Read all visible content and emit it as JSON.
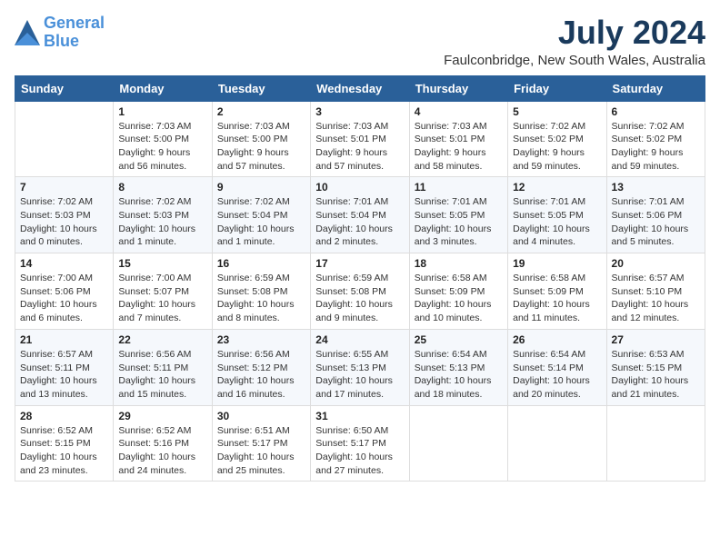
{
  "header": {
    "logo_line1": "General",
    "logo_line2": "Blue",
    "month_title": "July 2024",
    "location": "Faulconbridge, New South Wales, Australia"
  },
  "days_of_week": [
    "Sunday",
    "Monday",
    "Tuesday",
    "Wednesday",
    "Thursday",
    "Friday",
    "Saturday"
  ],
  "weeks": [
    [
      {
        "num": "",
        "sunrise": "",
        "sunset": "",
        "daylight": ""
      },
      {
        "num": "1",
        "sunrise": "Sunrise: 7:03 AM",
        "sunset": "Sunset: 5:00 PM",
        "daylight": "Daylight: 9 hours and 56 minutes."
      },
      {
        "num": "2",
        "sunrise": "Sunrise: 7:03 AM",
        "sunset": "Sunset: 5:00 PM",
        "daylight": "Daylight: 9 hours and 57 minutes."
      },
      {
        "num": "3",
        "sunrise": "Sunrise: 7:03 AM",
        "sunset": "Sunset: 5:01 PM",
        "daylight": "Daylight: 9 hours and 57 minutes."
      },
      {
        "num": "4",
        "sunrise": "Sunrise: 7:03 AM",
        "sunset": "Sunset: 5:01 PM",
        "daylight": "Daylight: 9 hours and 58 minutes."
      },
      {
        "num": "5",
        "sunrise": "Sunrise: 7:02 AM",
        "sunset": "Sunset: 5:02 PM",
        "daylight": "Daylight: 9 hours and 59 minutes."
      },
      {
        "num": "6",
        "sunrise": "Sunrise: 7:02 AM",
        "sunset": "Sunset: 5:02 PM",
        "daylight": "Daylight: 9 hours and 59 minutes."
      }
    ],
    [
      {
        "num": "7",
        "sunrise": "Sunrise: 7:02 AM",
        "sunset": "Sunset: 5:03 PM",
        "daylight": "Daylight: 10 hours and 0 minutes."
      },
      {
        "num": "8",
        "sunrise": "Sunrise: 7:02 AM",
        "sunset": "Sunset: 5:03 PM",
        "daylight": "Daylight: 10 hours and 1 minute."
      },
      {
        "num": "9",
        "sunrise": "Sunrise: 7:02 AM",
        "sunset": "Sunset: 5:04 PM",
        "daylight": "Daylight: 10 hours and 1 minute."
      },
      {
        "num": "10",
        "sunrise": "Sunrise: 7:01 AM",
        "sunset": "Sunset: 5:04 PM",
        "daylight": "Daylight: 10 hours and 2 minutes."
      },
      {
        "num": "11",
        "sunrise": "Sunrise: 7:01 AM",
        "sunset": "Sunset: 5:05 PM",
        "daylight": "Daylight: 10 hours and 3 minutes."
      },
      {
        "num": "12",
        "sunrise": "Sunrise: 7:01 AM",
        "sunset": "Sunset: 5:05 PM",
        "daylight": "Daylight: 10 hours and 4 minutes."
      },
      {
        "num": "13",
        "sunrise": "Sunrise: 7:01 AM",
        "sunset": "Sunset: 5:06 PM",
        "daylight": "Daylight: 10 hours and 5 minutes."
      }
    ],
    [
      {
        "num": "14",
        "sunrise": "Sunrise: 7:00 AM",
        "sunset": "Sunset: 5:06 PM",
        "daylight": "Daylight: 10 hours and 6 minutes."
      },
      {
        "num": "15",
        "sunrise": "Sunrise: 7:00 AM",
        "sunset": "Sunset: 5:07 PM",
        "daylight": "Daylight: 10 hours and 7 minutes."
      },
      {
        "num": "16",
        "sunrise": "Sunrise: 6:59 AM",
        "sunset": "Sunset: 5:08 PM",
        "daylight": "Daylight: 10 hours and 8 minutes."
      },
      {
        "num": "17",
        "sunrise": "Sunrise: 6:59 AM",
        "sunset": "Sunset: 5:08 PM",
        "daylight": "Daylight: 10 hours and 9 minutes."
      },
      {
        "num": "18",
        "sunrise": "Sunrise: 6:58 AM",
        "sunset": "Sunset: 5:09 PM",
        "daylight": "Daylight: 10 hours and 10 minutes."
      },
      {
        "num": "19",
        "sunrise": "Sunrise: 6:58 AM",
        "sunset": "Sunset: 5:09 PM",
        "daylight": "Daylight: 10 hours and 11 minutes."
      },
      {
        "num": "20",
        "sunrise": "Sunrise: 6:57 AM",
        "sunset": "Sunset: 5:10 PM",
        "daylight": "Daylight: 10 hours and 12 minutes."
      }
    ],
    [
      {
        "num": "21",
        "sunrise": "Sunrise: 6:57 AM",
        "sunset": "Sunset: 5:11 PM",
        "daylight": "Daylight: 10 hours and 13 minutes."
      },
      {
        "num": "22",
        "sunrise": "Sunrise: 6:56 AM",
        "sunset": "Sunset: 5:11 PM",
        "daylight": "Daylight: 10 hours and 15 minutes."
      },
      {
        "num": "23",
        "sunrise": "Sunrise: 6:56 AM",
        "sunset": "Sunset: 5:12 PM",
        "daylight": "Daylight: 10 hours and 16 minutes."
      },
      {
        "num": "24",
        "sunrise": "Sunrise: 6:55 AM",
        "sunset": "Sunset: 5:13 PM",
        "daylight": "Daylight: 10 hours and 17 minutes."
      },
      {
        "num": "25",
        "sunrise": "Sunrise: 6:54 AM",
        "sunset": "Sunset: 5:13 PM",
        "daylight": "Daylight: 10 hours and 18 minutes."
      },
      {
        "num": "26",
        "sunrise": "Sunrise: 6:54 AM",
        "sunset": "Sunset: 5:14 PM",
        "daylight": "Daylight: 10 hours and 20 minutes."
      },
      {
        "num": "27",
        "sunrise": "Sunrise: 6:53 AM",
        "sunset": "Sunset: 5:15 PM",
        "daylight": "Daylight: 10 hours and 21 minutes."
      }
    ],
    [
      {
        "num": "28",
        "sunrise": "Sunrise: 6:52 AM",
        "sunset": "Sunset: 5:15 PM",
        "daylight": "Daylight: 10 hours and 23 minutes."
      },
      {
        "num": "29",
        "sunrise": "Sunrise: 6:52 AM",
        "sunset": "Sunset: 5:16 PM",
        "daylight": "Daylight: 10 hours and 24 minutes."
      },
      {
        "num": "30",
        "sunrise": "Sunrise: 6:51 AM",
        "sunset": "Sunset: 5:17 PM",
        "daylight": "Daylight: 10 hours and 25 minutes."
      },
      {
        "num": "31",
        "sunrise": "Sunrise: 6:50 AM",
        "sunset": "Sunset: 5:17 PM",
        "daylight": "Daylight: 10 hours and 27 minutes."
      },
      {
        "num": "",
        "sunrise": "",
        "sunset": "",
        "daylight": ""
      },
      {
        "num": "",
        "sunrise": "",
        "sunset": "",
        "daylight": ""
      },
      {
        "num": "",
        "sunrise": "",
        "sunset": "",
        "daylight": ""
      }
    ]
  ]
}
